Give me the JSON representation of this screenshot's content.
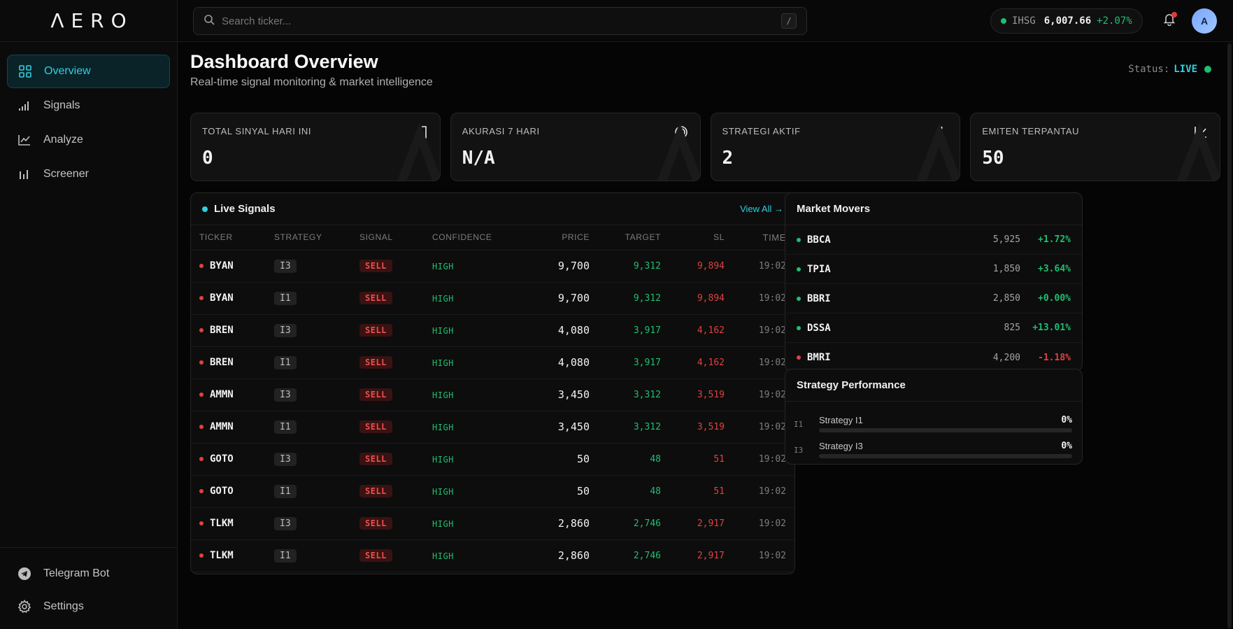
{
  "app": {
    "logo": "ΛERO"
  },
  "sidebar": {
    "items": [
      {
        "label": "Overview",
        "icon": "grid-icon",
        "active": true
      },
      {
        "label": "Signals",
        "icon": "signal-bars-icon"
      },
      {
        "label": "Analyze",
        "icon": "line-chart-icon"
      },
      {
        "label": "Screener",
        "icon": "bar-chart-icon"
      }
    ],
    "bottom": [
      {
        "label": "Telegram Bot",
        "icon": "telegram-icon"
      },
      {
        "label": "Settings",
        "icon": "gear-icon"
      }
    ]
  },
  "topbar": {
    "search_placeholder": "Search ticker...",
    "search_shortcut": "/",
    "index": {
      "name": "IHSG",
      "value": "6,007.66",
      "change": "+2.07%"
    },
    "avatar_initial": "A"
  },
  "page": {
    "title": "Dashboard Overview",
    "subtitle": "Real-time signal monitoring & market intelligence",
    "status_label": "Status:",
    "status_value": "LIVE"
  },
  "cards": [
    {
      "title": "TOTAL SINYAL HARI INI",
      "value": "0",
      "icon": "login-icon"
    },
    {
      "title": "AKURASI 7 HARI",
      "value": "N/A",
      "icon": "target-icon"
    },
    {
      "title": "STRATEGI AKTIF",
      "value": "2",
      "icon": "zap-icon"
    },
    {
      "title": "EMITEN TERPANTAU",
      "value": "50",
      "icon": "trend-icon"
    }
  ],
  "signals": {
    "title": "Live Signals",
    "view_all": "View All →",
    "columns": [
      "TICKER",
      "STRATEGY",
      "SIGNAL",
      "CONFIDENCE",
      "PRICE",
      "TARGET",
      "SL",
      "TIME"
    ],
    "rows": [
      {
        "ticker": "BYAN",
        "strategy": "I3",
        "signal": "SELL",
        "confidence": "HIGH",
        "price": "9,700",
        "target": "9,312",
        "sl": "9,894",
        "time": "19:02"
      },
      {
        "ticker": "BYAN",
        "strategy": "I1",
        "signal": "SELL",
        "confidence": "HIGH",
        "price": "9,700",
        "target": "9,312",
        "sl": "9,894",
        "time": "19:02"
      },
      {
        "ticker": "BREN",
        "strategy": "I3",
        "signal": "SELL",
        "confidence": "HIGH",
        "price": "4,080",
        "target": "3,917",
        "sl": "4,162",
        "time": "19:02"
      },
      {
        "ticker": "BREN",
        "strategy": "I1",
        "signal": "SELL",
        "confidence": "HIGH",
        "price": "4,080",
        "target": "3,917",
        "sl": "4,162",
        "time": "19:02"
      },
      {
        "ticker": "AMMN",
        "strategy": "I3",
        "signal": "SELL",
        "confidence": "HIGH",
        "price": "3,450",
        "target": "3,312",
        "sl": "3,519",
        "time": "19:02"
      },
      {
        "ticker": "AMMN",
        "strategy": "I1",
        "signal": "SELL",
        "confidence": "HIGH",
        "price": "3,450",
        "target": "3,312",
        "sl": "3,519",
        "time": "19:02"
      },
      {
        "ticker": "GOTO",
        "strategy": "I3",
        "signal": "SELL",
        "confidence": "HIGH",
        "price": "50",
        "target": "48",
        "sl": "51",
        "time": "19:02"
      },
      {
        "ticker": "GOTO",
        "strategy": "I1",
        "signal": "SELL",
        "confidence": "HIGH",
        "price": "50",
        "target": "48",
        "sl": "51",
        "time": "19:02"
      },
      {
        "ticker": "TLKM",
        "strategy": "I3",
        "signal": "SELL",
        "confidence": "HIGH",
        "price": "2,860",
        "target": "2,746",
        "sl": "2,917",
        "time": "19:02"
      },
      {
        "ticker": "TLKM",
        "strategy": "I1",
        "signal": "SELL",
        "confidence": "HIGH",
        "price": "2,860",
        "target": "2,746",
        "sl": "2,917",
        "time": "19:02"
      }
    ]
  },
  "movers": {
    "title": "Market Movers",
    "rows": [
      {
        "ticker": "BBCA",
        "price": "5,925",
        "change": "+1.72%",
        "up": true
      },
      {
        "ticker": "TPIA",
        "price": "1,850",
        "change": "+3.64%",
        "up": true
      },
      {
        "ticker": "BBRI",
        "price": "2,850",
        "change": "+0.00%",
        "up": true
      },
      {
        "ticker": "DSSA",
        "price": "825",
        "change": "+13.01%",
        "up": true
      },
      {
        "ticker": "BMRI",
        "price": "4,200",
        "change": "-1.18%",
        "up": false
      }
    ]
  },
  "strategy_performance": {
    "title": "Strategy Performance",
    "rows": [
      {
        "code": "I1",
        "name": "Strategy I1",
        "pct": "0%",
        "fill": 0
      },
      {
        "code": "I3",
        "name": "Strategy I3",
        "pct": "0%",
        "fill": 0
      }
    ]
  },
  "colors": {
    "accent": "#2fd0e0",
    "up": "#1fbf72",
    "down": "#e0423f"
  }
}
